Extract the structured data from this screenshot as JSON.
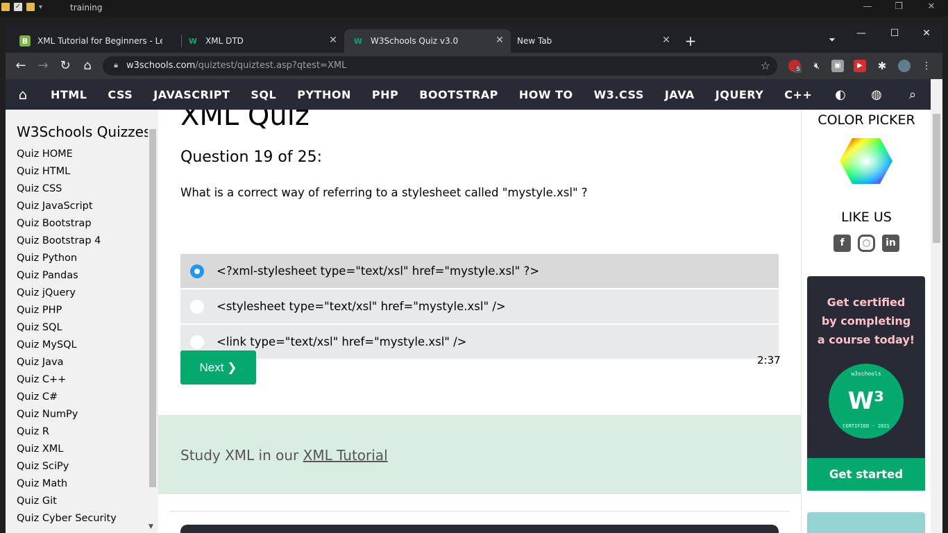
{
  "explorer": {
    "title": "training"
  },
  "tabs": [
    {
      "label": "XML Tutorial for Beginners - Lear",
      "favicon": "B"
    },
    {
      "label": "XML DTD",
      "favicon": "W"
    },
    {
      "label": "W3Schools Quiz v3.0",
      "favicon": "W"
    },
    {
      "label": "New Tab"
    }
  ],
  "address": {
    "host": "w3schools.com",
    "path": "/quiztest/quiztest.asp?qtest=XML"
  },
  "extensions": {
    "badge_count": "5"
  },
  "topnav": {
    "items": [
      "HTML",
      "CSS",
      "JAVASCRIPT",
      "SQL",
      "PYTHON",
      "PHP",
      "BOOTSTRAP",
      "HOW TO",
      "W3.CSS",
      "JAVA",
      "JQUERY",
      "C++"
    ]
  },
  "sidebar": {
    "title": "W3Schools Quizzes",
    "items": [
      "Quiz HOME",
      "Quiz HTML",
      "Quiz CSS",
      "Quiz JavaScript",
      "Quiz Bootstrap",
      "Quiz Bootstrap 4",
      "Quiz Python",
      "Quiz Pandas",
      "Quiz jQuery",
      "Quiz PHP",
      "Quiz SQL",
      "Quiz MySQL",
      "Quiz Java",
      "Quiz C++",
      "Quiz C#",
      "Quiz NumPy",
      "Quiz R",
      "Quiz XML",
      "Quiz SciPy",
      "Quiz Math",
      "Quiz Git",
      "Quiz Cyber Security"
    ]
  },
  "quiz": {
    "title": "XML Quiz",
    "question_number": "Question 19 of 25:",
    "question": "What is a correct way of referring to a stylesheet called \"mystyle.xsl\" ?",
    "options": [
      {
        "text": "<?xml-stylesheet type=\"text/xsl\" href=\"mystyle.xsl\" ?>",
        "selected": true
      },
      {
        "text": "<stylesheet type=\"text/xsl\" href=\"mystyle.xsl\" />",
        "selected": false
      },
      {
        "text": "<link type=\"text/xsl\" href=\"mystyle.xsl\" />",
        "selected": false
      }
    ],
    "next_label": "Next ❯",
    "timer": "2:37"
  },
  "study": {
    "prefix": "Study XML in our ",
    "link": "XML Tutorial"
  },
  "right": {
    "color_picker_title": "COLOR PICKER",
    "like_title": "LIKE US",
    "cert_line1": "Get certified",
    "cert_line2": "by completing",
    "cert_line3": "a course today!",
    "badge_top": "w3schools",
    "badge_bottom": "CERTIFIED · 2021",
    "get_started": "Get started"
  },
  "colors": {
    "brand_green": "#04aa6d",
    "nav_dark": "#282a35",
    "study_bg": "#d9eee1",
    "radio_blue": "#2196F3"
  }
}
